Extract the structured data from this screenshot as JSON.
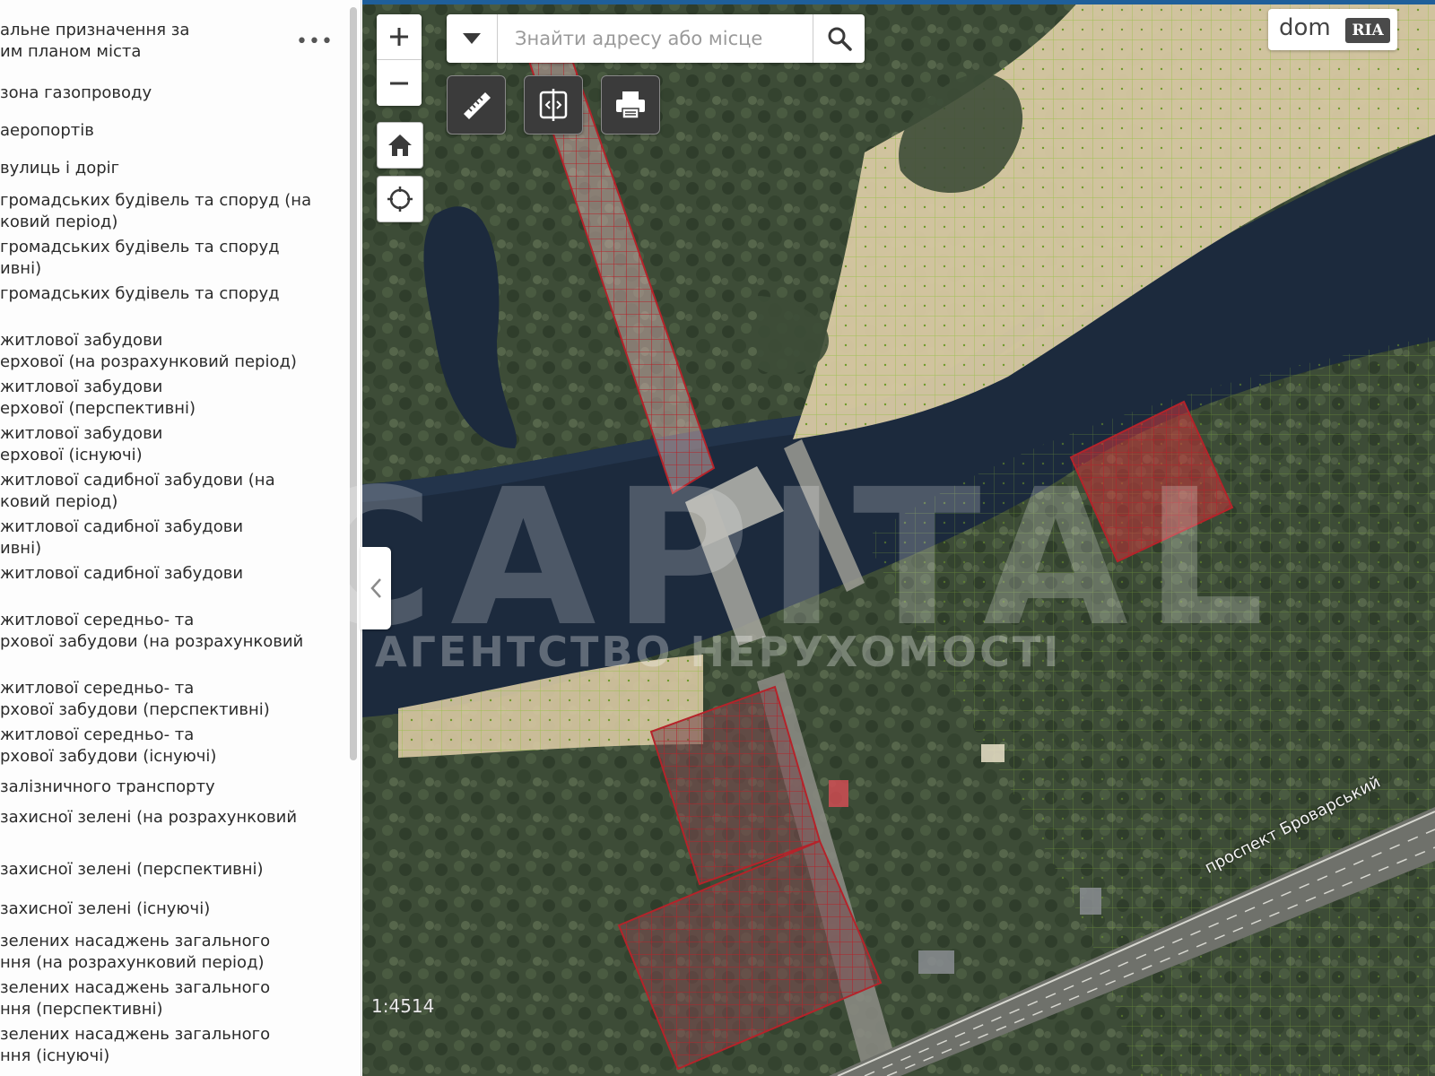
{
  "legend": {
    "title": "альне призначення за\nим планом міста",
    "more_label": "•••",
    "items": [
      "зона газопроводу",
      "аеропортів",
      "вулиць і доріг",
      "громадських будівель та споруд (на\nковий період)",
      "громадських будівель та споруд\nивні)",
      "громадських будівель та споруд",
      "житлової забудови\nерхової (на розрахунковий період)",
      "житлової забудови\nерхової (перспективні)",
      "житлової забудови\nерхової (існуючі)",
      "житлової садибної забудови (на\nковий період)",
      "житлової садибної забудови\nивні)",
      "житлової садибної забудови",
      "житлової середньо- та\nрхової забудови (на розрахунковий",
      "житлової середньо- та\nрхової забудови (перспективні)",
      "житлової середньо- та\nрхової забудови (існуючі)",
      "залізничного транспорту",
      "захисної зелені (на розрахунковий",
      "захисної зелені (перспективні)",
      "захисної зелені (існуючі)",
      "зелених насаджень загального\nння (на розрахунковий період)",
      "зелених насаджень загального\nння (перспективні)",
      "зелених насаджень загального\nння (існуючі)"
    ]
  },
  "search": {
    "placeholder": "Знайти адресу або місце"
  },
  "icons": {
    "zoom_in": "plus-icon",
    "zoom_out": "minus-icon",
    "home": "home-icon",
    "locate": "locate-icon",
    "dropdown": "chevron-down-icon",
    "search": "search-icon",
    "measure": "ruler-icon",
    "swipe": "swipe-compare-icon",
    "print": "printer-icon",
    "collapse": "chevron-left-icon"
  },
  "map": {
    "scale": "1:4514",
    "street_label": "проспект Броварський",
    "colors": {
      "water": "#1c2a3d",
      "forest": "#3d4c37",
      "sand": "#d8c9a3",
      "green_zone_hatch": "#8fbf3a",
      "residential_zone": "#b5232a"
    }
  },
  "watermark": {
    "brand": "CAPITAL",
    "subtitle": "АГЕНТСТВО НЕРУХОМОСТІ"
  },
  "logo": {
    "dom": "dom",
    "ria": "RIA"
  }
}
